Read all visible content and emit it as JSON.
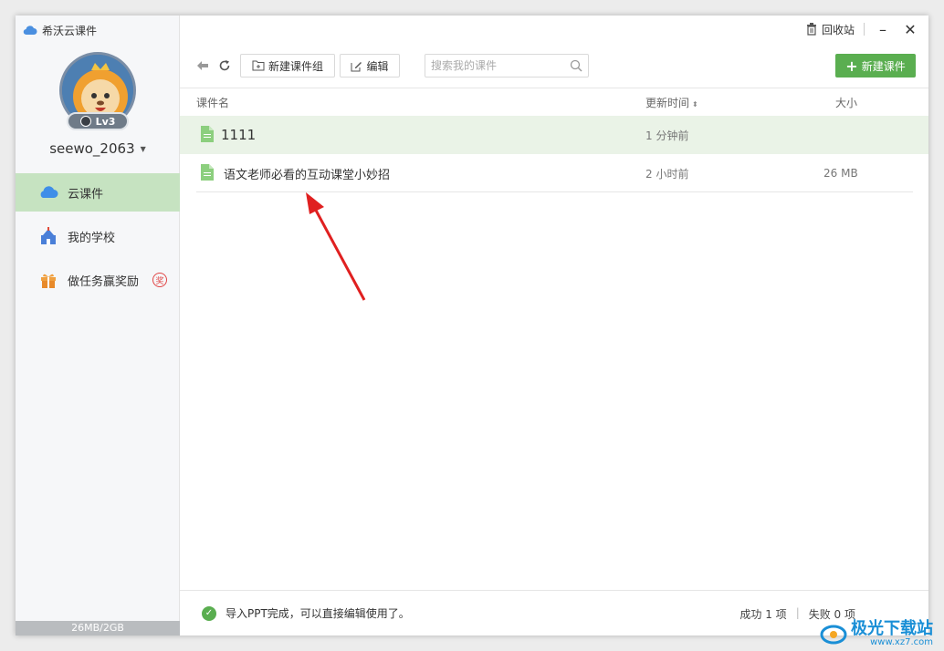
{
  "app": {
    "title": "希沃云课件"
  },
  "user": {
    "name": "seewo_2063",
    "level": "Lv3"
  },
  "sidebar": {
    "items": [
      {
        "label": "云课件",
        "icon": "cloud-icon",
        "active": true
      },
      {
        "label": "我的学校",
        "icon": "school-icon",
        "active": false
      },
      {
        "label": "做任务赢奖励",
        "icon": "gift-icon",
        "active": false,
        "badge": "奖"
      }
    ],
    "storage": "26MB/2GB"
  },
  "titlebar": {
    "recycle_label": "回收站",
    "minimize": "–",
    "close": "✕"
  },
  "toolbar": {
    "new_group_label": "新建课件组",
    "edit_label": "编辑",
    "search_placeholder": "搜索我的课件",
    "new_courseware_label": "新建课件"
  },
  "table": {
    "columns": {
      "name": "课件名",
      "updated": "更新时间",
      "size": "大小"
    },
    "rows": [
      {
        "name": "1111",
        "updated": "1 分钟前",
        "size": ""
      },
      {
        "name": "语文老师必看的互动课堂小妙招",
        "updated": "2 小时前",
        "size": "26 MB"
      }
    ]
  },
  "status": {
    "message": "导入PPT完成，可以直接编辑使用了。",
    "success": "成功 1 项",
    "fail": "失败 0 项"
  },
  "watermark": {
    "brand": "极光下载站",
    "url": "www.xz7.com"
  },
  "colors": {
    "accent": "#5aae50",
    "active_nav": "#c6e3c1",
    "arrow": "#e02020"
  }
}
